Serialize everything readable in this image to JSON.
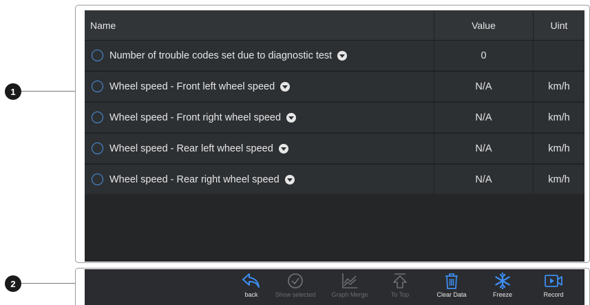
{
  "callouts": [
    "1",
    "2"
  ],
  "table": {
    "headers": {
      "name": "Name",
      "value": "Value",
      "unit": "Uint"
    },
    "rows": [
      {
        "name": "Number of trouble codes set due to diagnostic test",
        "value": "0",
        "unit": ""
      },
      {
        "name": "Wheel speed - Front left wheel speed",
        "value": "N/A",
        "unit": "km/h"
      },
      {
        "name": "Wheel speed - Front right wheel speed",
        "value": "N/A",
        "unit": "km/h"
      },
      {
        "name": "Wheel speed - Rear left wheel speed",
        "value": "N/A",
        "unit": "km/h"
      },
      {
        "name": "Wheel speed - Rear right wheel speed",
        "value": "N/A",
        "unit": "km/h"
      }
    ]
  },
  "toolbar": {
    "back": "back",
    "show_selected": "Show selected",
    "graph_merge": "Graph Merge",
    "to_top": "To Top",
    "clear_data": "Clear Data",
    "freeze": "Freeze",
    "record": "Record"
  },
  "colors": {
    "accent": "#3d8ef0",
    "disabled": "#6a6d72",
    "panel": "#242628"
  }
}
